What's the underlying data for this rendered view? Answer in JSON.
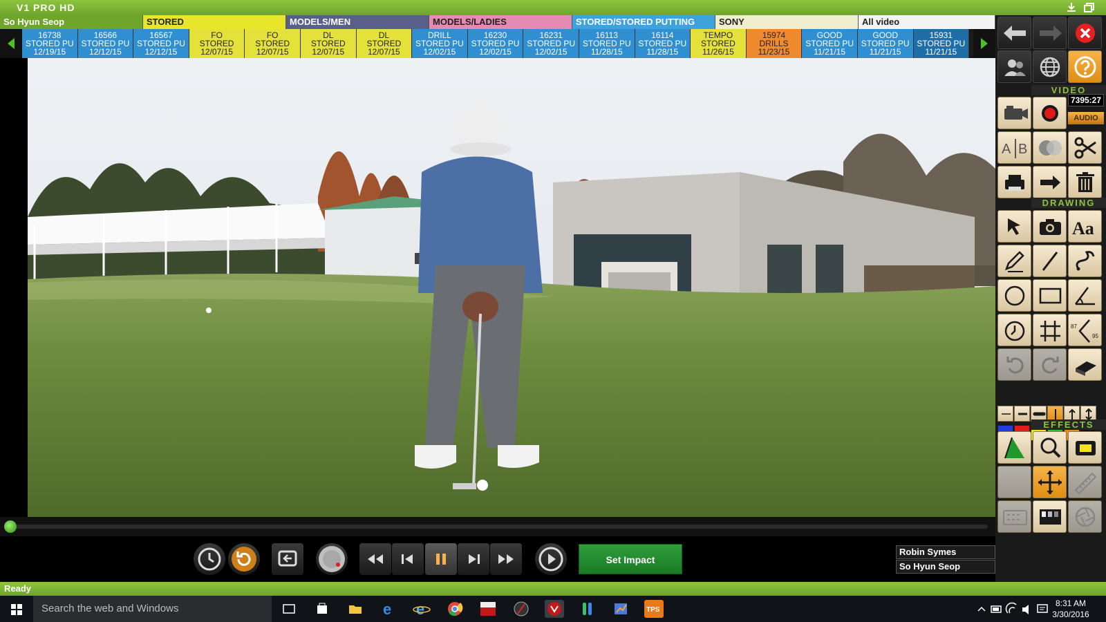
{
  "app": {
    "title": "V1 PRO HD"
  },
  "categories": [
    {
      "label": "So Hyun Seop",
      "color": "#6ea52a",
      "text": "#ffffff",
      "w": 207
    },
    {
      "label": "STORED",
      "color": "#e7e62a",
      "text": "#222222",
      "w": 207
    },
    {
      "label": "MODELS/MEN",
      "color": "#5a5f8a",
      "text": "#ffffff",
      "w": 207
    },
    {
      "label": "MODELS/LADIES",
      "color": "#e58ab3",
      "text": "#222222",
      "w": 207
    },
    {
      "label": "STORED/STORED PUTTING",
      "color": "#3ea2dc",
      "text": "#ffffff",
      "w": 207
    },
    {
      "label": "SONY",
      "color": "#f0eecf",
      "text": "#222222",
      "w": 207
    },
    {
      "label": "All video",
      "color": "#f4f4f4",
      "text": "#222222",
      "w": 198
    }
  ],
  "thumbnails": [
    {
      "l1": "16738",
      "l2": "STORED PU",
      "l3": "12/19/15",
      "color": "#2f8fd0",
      "dark": false
    },
    {
      "l1": "16566",
      "l2": "STORED PU",
      "l3": "12/12/15",
      "color": "#2f8fd0",
      "dark": false
    },
    {
      "l1": "16567",
      "l2": "STORED PU",
      "l3": "12/12/15",
      "color": "#2f8fd0",
      "dark": false
    },
    {
      "l1": "FO",
      "l2": "STORED",
      "l3": "12/07/15",
      "color": "#e4e23a",
      "dark": true
    },
    {
      "l1": "FO",
      "l2": "STORED",
      "l3": "12/07/15",
      "color": "#e4e23a",
      "dark": true
    },
    {
      "l1": "DL",
      "l2": "STORED",
      "l3": "12/07/15",
      "color": "#e4e23a",
      "dark": true
    },
    {
      "l1": "DL",
      "l2": "STORED",
      "l3": "12/07/15",
      "color": "#e4e23a",
      "dark": true
    },
    {
      "l1": "DRILL",
      "l2": "STORED PU",
      "l3": "12/02/15",
      "color": "#2f8fd0",
      "dark": false
    },
    {
      "l1": "16230",
      "l2": "STORED PU",
      "l3": "12/02/15",
      "color": "#2f8fd0",
      "dark": false
    },
    {
      "l1": "16231",
      "l2": "STORED PU",
      "l3": "12/02/15",
      "color": "#2f8fd0",
      "dark": false
    },
    {
      "l1": "16113",
      "l2": "STORED PU",
      "l3": "11/28/15",
      "color": "#2f8fd0",
      "dark": false
    },
    {
      "l1": "16114",
      "l2": "STORED PU",
      "l3": "11/28/15",
      "color": "#2f8fd0",
      "dark": false
    },
    {
      "l1": "TEMPO",
      "l2": "STORED",
      "l3": "11/26/15",
      "color": "#e4e23a",
      "dark": true
    },
    {
      "l1": "15974",
      "l2": "DRILLS",
      "l3": "11/23/15",
      "color": "#f08a2e",
      "dark": true
    },
    {
      "l1": "GOOD",
      "l2": "STORED PU",
      "l3": "11/21/15",
      "color": "#2f8fd0",
      "dark": false
    },
    {
      "l1": "GOOD",
      "l2": "STORED PU",
      "l3": "11/21/15",
      "color": "#2f8fd0",
      "dark": false
    },
    {
      "l1": "15931",
      "l2": "STORED PU",
      "l3": "11/21/15",
      "color": "#1f6ea8",
      "dark": false
    }
  ],
  "controls": {
    "set_impact": "Set Impact",
    "names": [
      "Robin Symes",
      "So Hyun Seop"
    ]
  },
  "panel": {
    "video_label": "VIDEO",
    "drawing_label": "DRAWING",
    "effects_label": "EFFECTS",
    "time": "7395:27",
    "audio": "AUDIO",
    "ab_label": "A B"
  },
  "status": {
    "text": "Ready"
  },
  "taskbar": {
    "search_placeholder": "Search the web and Windows",
    "time": "8:31 AM",
    "date": "3/30/2016"
  },
  "colors": {
    "accent": "#8dc43f",
    "swatches": [
      "#1f3de0",
      "#e11d1d",
      "#f4e21a",
      "#1fcf2a",
      "#f08a1e",
      "#111111"
    ]
  }
}
